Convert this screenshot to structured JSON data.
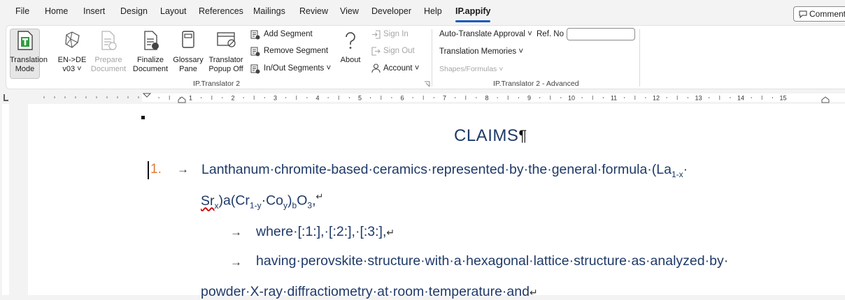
{
  "tabs": [
    "File",
    "Home",
    "Insert",
    "Design",
    "Layout",
    "References",
    "Mailings",
    "Review",
    "View",
    "Developer",
    "Help",
    "IP.appify"
  ],
  "comments_label": "Comments",
  "ribbon": {
    "translation_mode": [
      "Translation",
      "Mode"
    ],
    "lang_pair": [
      "EN->DE",
      "v03 ˅"
    ],
    "prepare_document": [
      "Prepare",
      "Document"
    ],
    "finalize_document": [
      "Finalize",
      "Document"
    ],
    "glossary_pane": [
      "Glossary",
      "Pane"
    ],
    "translator_popup": [
      "Translator",
      "Popup Off"
    ],
    "add_segment": "Add Segment",
    "remove_segment": "Remove Segment",
    "inout_segments": "In/Out Segments ˅",
    "about": "About",
    "sign_in": "Sign In",
    "sign_out": "Sign Out",
    "account": "Account ˅",
    "auto_translate": "Auto-Translate Approval ˅",
    "ref_no_label": "Ref. No",
    "ref_no_value": "",
    "translation_memories": "Translation Memories ˅",
    "shapes_formulas": "Shapes/Formulas ˅",
    "group1_label": "IP.Translator 2",
    "group2_label": "IP.Translator 2 - Advanced"
  },
  "ruler_numbers": [
    "1",
    "2",
    "3",
    "4",
    "5",
    "6",
    "7",
    "8",
    "9",
    "10",
    "11",
    "12",
    "13",
    "14",
    "15"
  ],
  "document": {
    "heading": "CLAIMS",
    "pilcrow": "¶",
    "claim_number": "1.",
    "arrow": "→",
    "line1": "Lanthanum·chromite-based·ceramics·represented·by·the·general·formula·(La",
    "line1_sub": "1-x",
    "line1_end": "·",
    "line2_sr": "Sr",
    "line2_x": "x",
    "line2_a": ")a(Cr",
    "line2_sub1": "1-y",
    "line2_co": "·Co",
    "line2_sub2": "y",
    "line2_b": ")",
    "line2_bsub": "b",
    "line2_o": "O",
    "line2_3": "3",
    "line2_end": ",",
    "return_mark": "↵",
    "line3": "where·[:1:],·[:2:],·[:3:],",
    "line4": "having·perovskite·structure·with·a·hexagonal·lattice·structure·as·analyzed·by·",
    "line5": "powder·X-ray·diffractiometry·at·room·temperature·and"
  },
  "colors": {
    "accent": "#185abd",
    "text": "#1f3a68",
    "number": "#e07b39"
  }
}
